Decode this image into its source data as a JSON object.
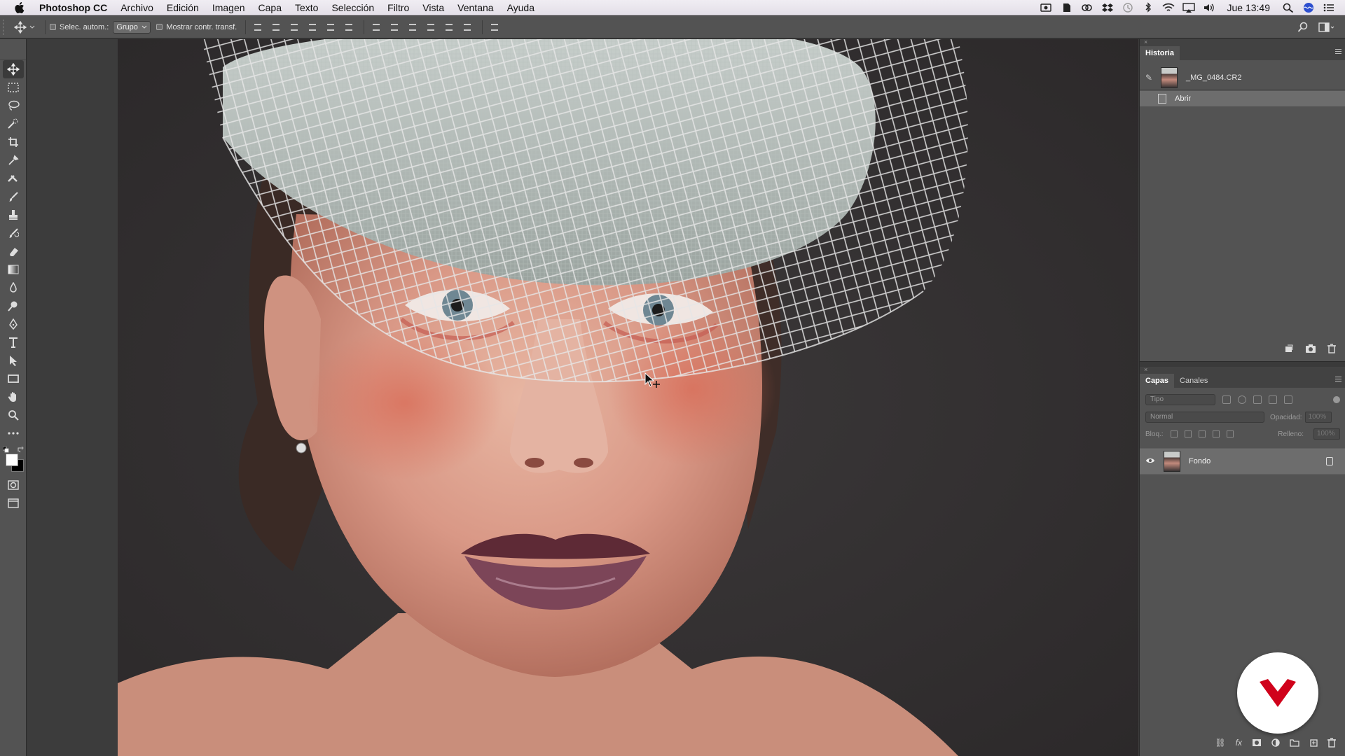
{
  "menubar": {
    "app_name": "Photoshop CC",
    "items": [
      "Archivo",
      "Edición",
      "Imagen",
      "Capa",
      "Texto",
      "Selección",
      "Filtro",
      "Vista",
      "Ventana",
      "Ayuda"
    ],
    "clock": "Jue 13:49"
  },
  "options": {
    "auto_select_label": "Selec. autom.:",
    "auto_select_value": "Grupo",
    "transform_label": "Mostrar contr. transf."
  },
  "history": {
    "tab_label": "Historia",
    "snapshot_name": "_MG_0484.CR2",
    "steps": [
      "Abrir"
    ]
  },
  "layers": {
    "tabs": [
      "Capas",
      "Canales"
    ],
    "filter_placeholder": "Tipo",
    "blend_mode": "Normal",
    "opacity_label": "Opacidad:",
    "opacity_value": "100%",
    "lock_label": "Bloq.:",
    "fill_label": "Relleno:",
    "fill_value": "100%",
    "items": [
      {
        "name": "Fondo",
        "visible": true,
        "locked": true
      }
    ]
  },
  "colors": {
    "foreground": "#ffffff",
    "background": "#000000",
    "panel_bg": "#535353",
    "canvas_bg": "#3c3c3c",
    "brand_red": "#d0021b"
  },
  "icons": {
    "toolbox": [
      "move-icon",
      "marquee-icon",
      "lasso-icon",
      "quick-select-icon",
      "crop-icon",
      "eyedropper-icon",
      "healing-icon",
      "brush-icon",
      "stamp-icon",
      "history-brush-icon",
      "eraser-icon",
      "gradient-icon",
      "blur-icon",
      "dodge-icon",
      "pen-icon",
      "type-icon",
      "path-select-icon",
      "rectangle-icon",
      "hand-icon",
      "zoom-icon",
      "more-tools-icon"
    ]
  }
}
